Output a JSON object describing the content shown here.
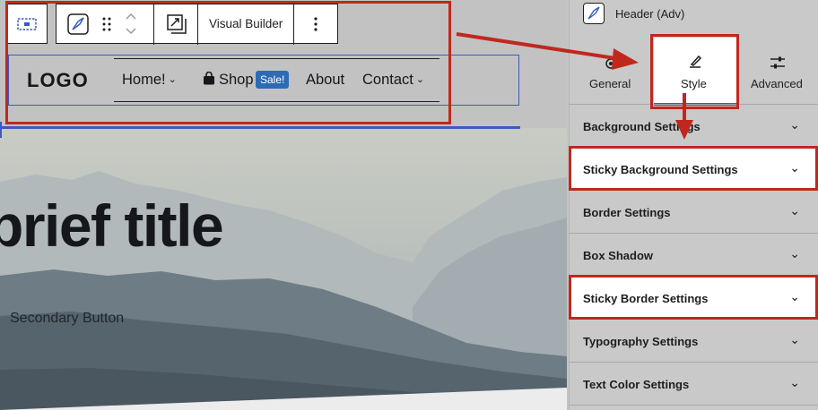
{
  "canvas": {
    "hero_title": "brief title",
    "secondary_button": "Secondary Button"
  },
  "toolbar": {
    "block_icon": "block-placeholder-icon",
    "builder_icon": "compass-icon",
    "drag_icon": "drag-handle-icon",
    "move_icons": [
      "chevron-up-icon",
      "chevron-down-icon"
    ],
    "transform_icon": "transform-icon",
    "visual_builder_label": "Visual Builder",
    "more_icon": "more-vertical-icon"
  },
  "header_block": {
    "logo": "LOGO",
    "nav": [
      {
        "label": "Home!",
        "has_dropdown": true
      },
      {
        "label": "Shop",
        "has_dropdown": false,
        "icon": "shopping-bag-icon"
      },
      {
        "label": "About",
        "has_dropdown": false
      },
      {
        "label": "Contact",
        "has_dropdown": true
      }
    ],
    "sale_badge": "Sale!",
    "chevron": "⌄"
  },
  "panel": {
    "title": "Header (Adv)",
    "title_icon": "compass-icon",
    "tabs": [
      {
        "label": "General",
        "icon": "gear-icon"
      },
      {
        "label": "Style",
        "icon": "brush-icon",
        "active": true
      },
      {
        "label": "Advanced",
        "icon": "sliders-icon"
      }
    ],
    "sections": [
      {
        "label": "Background Settings"
      },
      {
        "label": "Sticky Background Settings",
        "highlighted": true
      },
      {
        "label": "Border Settings"
      },
      {
        "label": "Box Shadow"
      },
      {
        "label": "Sticky Border Settings",
        "highlighted": true
      },
      {
        "label": "Typography Settings"
      },
      {
        "label": "Text Color Settings"
      }
    ],
    "chevron": "⌄"
  },
  "colors": {
    "annotation_red": "#c0281e",
    "selection_blue": "#3a5bbf",
    "sale_badge": "#2e6bb5"
  }
}
